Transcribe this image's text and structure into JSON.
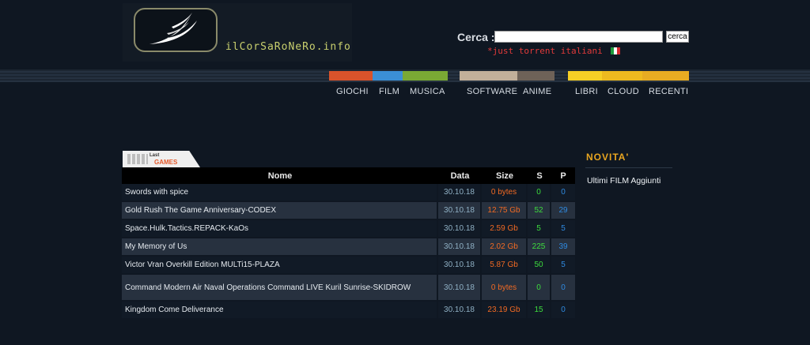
{
  "header": {
    "logo_text": "ilCorSaRoNeRo.info",
    "search_label": "Cerca :",
    "search_value": "",
    "search_button": "cerca",
    "tagline": "*just torrent italiani"
  },
  "nav": {
    "strip_colors": [
      "#d9532b",
      "#3b8fd6",
      "#7aa934",
      "#c2b09a",
      "#6e6258",
      "#f0c61a",
      "#e8ac22"
    ],
    "items": [
      "GIOCHI",
      "FILM",
      "MUSICA",
      "SOFTWARE",
      "ANIME",
      "LIBRI",
      "CLOUD",
      "RECENTI"
    ]
  },
  "section": {
    "badge_small": "Last",
    "badge_label": "GAMES"
  },
  "table": {
    "headers": [
      "Nome",
      "Data",
      "Size",
      "S",
      "P"
    ],
    "rows": [
      {
        "name": "Swords with spice",
        "date": "30.10.18",
        "size": "0 bytes",
        "seeds": "0",
        "peers": "0"
      },
      {
        "name": "Gold Rush The Game Anniversary-CODEX",
        "date": "30.10.18",
        "size": "12.75 Gb",
        "seeds": "52",
        "peers": "29"
      },
      {
        "name": "Space.Hulk.Tactics.REPACK-KaOs",
        "date": "30.10.18",
        "size": "2.59 Gb",
        "seeds": "5",
        "peers": "5"
      },
      {
        "name": "My Memory of Us",
        "date": "30.10.18",
        "size": "2.02 Gb",
        "seeds": "225",
        "peers": "39"
      },
      {
        "name": "Victor Vran Overkill Edition MULTi15-PLAZA",
        "date": "30.10.18",
        "size": "5.87 Gb",
        "seeds": "50",
        "peers": "5"
      },
      {
        "name": "Command Modern Air Naval Operations Command LIVE Kuril Sunrise-SKIDROW",
        "date": "30.10.18",
        "size": "0 bytes",
        "seeds": "0",
        "peers": "0"
      },
      {
        "name": "Kingdom Come Deliverance",
        "date": "30.10.18",
        "size": "23.19 Gb",
        "seeds": "15",
        "peers": "0"
      }
    ]
  },
  "sidebar": {
    "title": "NOVITA'",
    "link": "Ultimi FILM Aggiunti"
  }
}
